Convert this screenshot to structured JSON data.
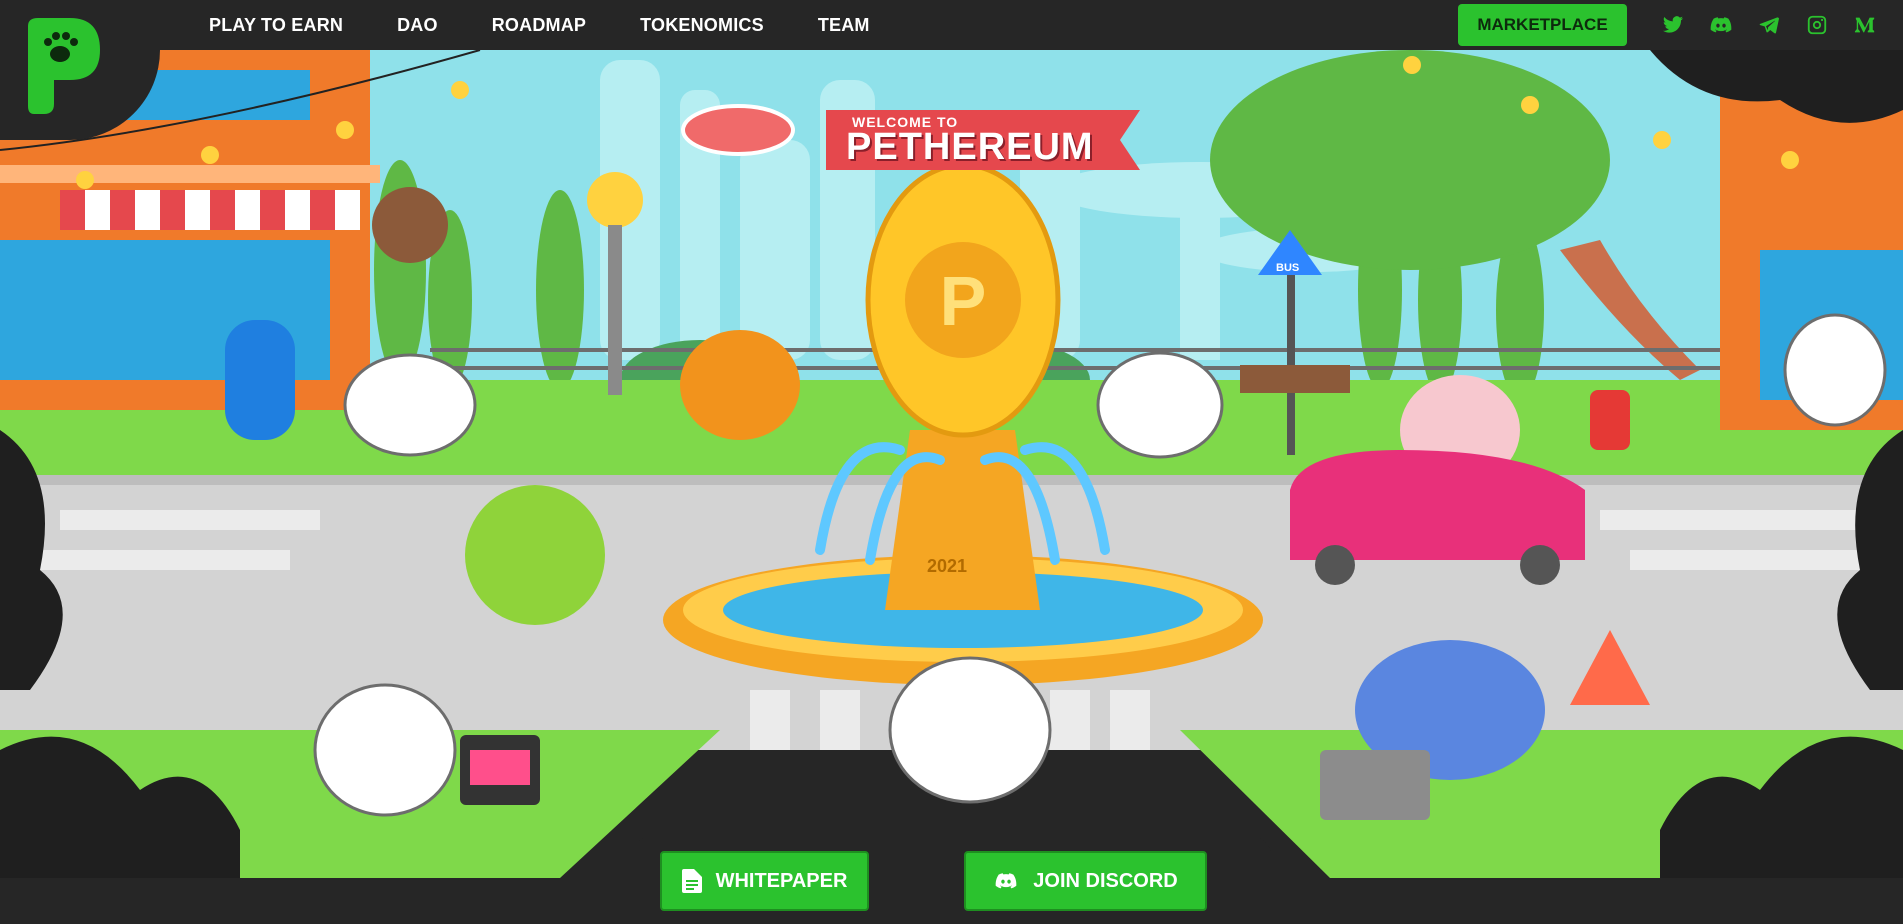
{
  "brand": {
    "logo_name": "pethereum-logo",
    "accent": "#2bc22e",
    "nav_bg": "#262626"
  },
  "nav": {
    "links": [
      "PLAY TO EARN",
      "DAO",
      "ROADMAP",
      "TOKENOMICS",
      "TEAM"
    ],
    "marketplace_label": "MARKETPLACE",
    "socials": [
      "twitter-icon",
      "discord-icon",
      "telegram-icon",
      "instagram-icon",
      "medium-icon"
    ]
  },
  "hero": {
    "banner_small": "WELCOME TO",
    "banner_large": "PETHEREUM",
    "bus_sign": "BUS",
    "fountain_year": "2021"
  },
  "cta": {
    "whitepaper_label": "WHITEPAPER",
    "discord_label": "JOIN DISCORD"
  }
}
